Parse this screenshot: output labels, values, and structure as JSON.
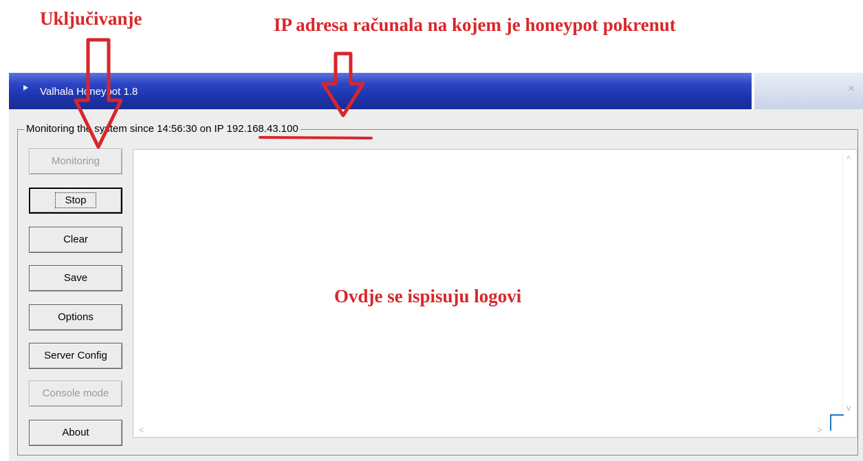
{
  "annotations": {
    "enable_label": "Uključivanje",
    "ip_label": "IP adresa računala na kojem je honeypot pokrenut",
    "logs_label": "Ovdje se ispisuju logovi"
  },
  "window": {
    "title": "Valhala Honeypot 1.8",
    "close_glyph": "×"
  },
  "group": {
    "legend": "Monitoring the system since 14:56:30 on IP 192.168.43.100"
  },
  "buttons": [
    {
      "label": "Monitoring",
      "state": "disabled"
    },
    {
      "label": "Stop",
      "state": "focused"
    },
    {
      "label": "Clear",
      "state": "normal"
    },
    {
      "label": "Save",
      "state": "normal"
    },
    {
      "label": "Options",
      "state": "normal"
    },
    {
      "label": "Server Config",
      "state": "normal"
    },
    {
      "label": "Console mode",
      "state": "disabled"
    },
    {
      "label": "About",
      "state": "normal"
    }
  ],
  "scroll": {
    "up": "^",
    "down": "v",
    "left": "<",
    "right": ">"
  },
  "colors": {
    "annotation": "#d9262a",
    "titlebar": "#1c32a9"
  }
}
